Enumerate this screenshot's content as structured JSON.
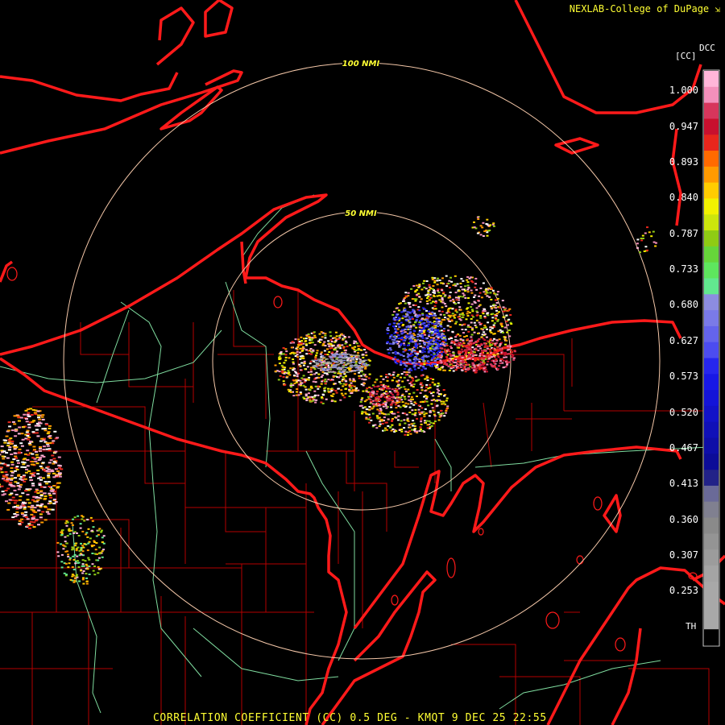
{
  "header": {
    "credit": "NEXLAB-College of DuPage",
    "credit_icon": "corner-arrow-icon"
  },
  "footer": {
    "product_line": "CORRELATION COEFFICIENT (CC) 0.5 DEG - KMQT 9 DEC 25 22:55"
  },
  "range_rings": [
    {
      "label": "100 NMI",
      "distance_nmi": 100
    },
    {
      "label": "50 NMI",
      "distance_nmi": 50
    }
  ],
  "colorbar": {
    "unit": "[CC]",
    "code": "DCC",
    "bottom_label": "TH",
    "labels": [
      "1.000",
      "0.947",
      "0.893",
      "0.840",
      "0.787",
      "0.733",
      "0.680",
      "0.627",
      "0.573",
      "0.520",
      "0.467",
      "0.413",
      "0.360",
      "0.307",
      "0.253"
    ],
    "colors": [
      "#ffb6d9",
      "#f390bb",
      "#d7365c",
      "#c8102e",
      "#e8261c",
      "#ff6a00",
      "#ff9a00",
      "#ffcc00",
      "#f2f200",
      "#cce60c",
      "#8fcc14",
      "#66d63a",
      "#5ee65e",
      "#62e88f",
      "#8c8ce0",
      "#7a7ae8",
      "#6464ec",
      "#4c4cf0",
      "#2626ee",
      "#1818e6",
      "#1414d8",
      "#1212c8",
      "#1010b8",
      "#0e0ea8",
      "#0c0c98",
      "#222288",
      "#6a6a98",
      "#808090",
      "#8a8a8a",
      "#949494",
      "#9c9c9c",
      "#a4a4a4",
      "#a8a8a8",
      "#a8a8a8",
      "#a8a8a8",
      "#000000"
    ]
  },
  "styles": {
    "state_border": "#ff1a1a",
    "county_border": "#b40000",
    "river": "#7fdc9f",
    "ring": "#f4c7a8",
    "label": "#ffff33"
  }
}
